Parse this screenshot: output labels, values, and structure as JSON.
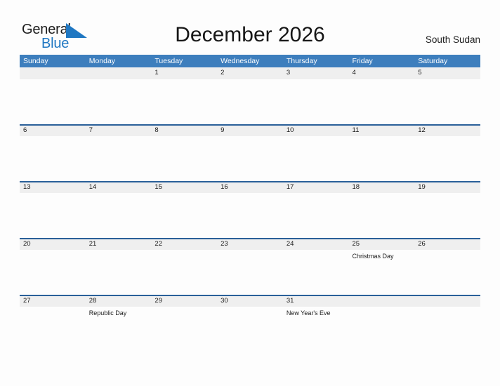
{
  "brand": {
    "name_part1": "General",
    "name_part2": "Blue",
    "flag_icon": "blue-triangle-flag-icon",
    "accent_color": "#1f77c2"
  },
  "header": {
    "title": "December 2026",
    "region": "South Sudan"
  },
  "theme": {
    "header_blue": "#3d7ebd",
    "rule_blue": "#2a6099",
    "band_gray": "#efefef",
    "page_background": "#fdfdfd"
  },
  "calendar": {
    "weekdays": [
      "Sunday",
      "Monday",
      "Tuesday",
      "Wednesday",
      "Thursday",
      "Friday",
      "Saturday"
    ],
    "weeks": [
      [
        {
          "day": "",
          "event": ""
        },
        {
          "day": "",
          "event": ""
        },
        {
          "day": "1",
          "event": ""
        },
        {
          "day": "2",
          "event": ""
        },
        {
          "day": "3",
          "event": ""
        },
        {
          "day": "4",
          "event": ""
        },
        {
          "day": "5",
          "event": ""
        }
      ],
      [
        {
          "day": "6",
          "event": ""
        },
        {
          "day": "7",
          "event": ""
        },
        {
          "day": "8",
          "event": ""
        },
        {
          "day": "9",
          "event": ""
        },
        {
          "day": "10",
          "event": ""
        },
        {
          "day": "11",
          "event": ""
        },
        {
          "day": "12",
          "event": ""
        }
      ],
      [
        {
          "day": "13",
          "event": ""
        },
        {
          "day": "14",
          "event": ""
        },
        {
          "day": "15",
          "event": ""
        },
        {
          "day": "16",
          "event": ""
        },
        {
          "day": "17",
          "event": ""
        },
        {
          "day": "18",
          "event": ""
        },
        {
          "day": "19",
          "event": ""
        }
      ],
      [
        {
          "day": "20",
          "event": ""
        },
        {
          "day": "21",
          "event": ""
        },
        {
          "day": "22",
          "event": ""
        },
        {
          "day": "23",
          "event": ""
        },
        {
          "day": "24",
          "event": ""
        },
        {
          "day": "25",
          "event": "Christmas Day"
        },
        {
          "day": "26",
          "event": ""
        }
      ],
      [
        {
          "day": "27",
          "event": ""
        },
        {
          "day": "28",
          "event": "Republic Day"
        },
        {
          "day": "29",
          "event": ""
        },
        {
          "day": "30",
          "event": ""
        },
        {
          "day": "31",
          "event": "New Year's Eve"
        },
        {
          "day": "",
          "event": ""
        },
        {
          "day": "",
          "event": ""
        }
      ]
    ]
  }
}
